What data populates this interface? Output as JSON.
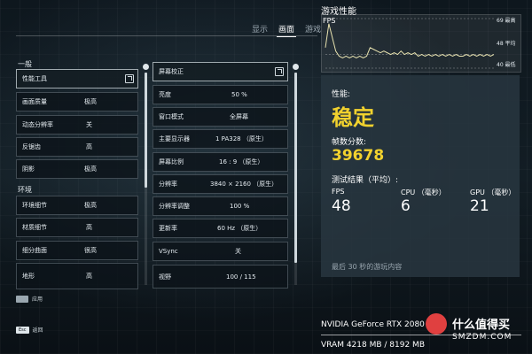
{
  "tabs": [
    "显示",
    "画面",
    "游戏"
  ],
  "active_tab": "画面",
  "sections": {
    "general": "一般",
    "environment": "环境"
  },
  "left_column": [
    {
      "label": "性能工具",
      "value": "",
      "icon": "external-icon"
    },
    {
      "label": "画面质量",
      "value": "极高"
    },
    {
      "label": "动态分辨率",
      "value": "关"
    },
    {
      "label": "反锯齿",
      "value": "高"
    },
    {
      "label": "阴影",
      "value": "极高"
    },
    {
      "label": "环境细节",
      "value": "极高"
    },
    {
      "label": "材质细节",
      "value": "高"
    },
    {
      "label": "细分曲面",
      "value": "很高"
    },
    {
      "label": "地形",
      "value": "高"
    }
  ],
  "right_column": [
    {
      "label": "屏幕校正",
      "value": "",
      "icon": "external-icon"
    },
    {
      "label": "亮度",
      "value": "50 %"
    },
    {
      "label": "窗口模式",
      "value": "全屏幕"
    },
    {
      "label": "主要显示器",
      "value": "1 PA328 （原生）"
    },
    {
      "label": "屏幕比例",
      "value": "16 : 9 （原生）"
    },
    {
      "label": "分辨率",
      "value": "3840 × 2160 （原生）"
    },
    {
      "label": "分辨率调整",
      "value": "100 %"
    },
    {
      "label": "更新率",
      "value": "60 Hz （原生）"
    },
    {
      "label": "VSync",
      "value": "关"
    },
    {
      "label": "视野",
      "value": "100 / 115"
    }
  ],
  "bottom": {
    "apply": "应用",
    "back_key": "Esc",
    "back": "返回"
  },
  "perf": {
    "title": "游戏性能",
    "graph_label": "FPS",
    "graph_max": "69 最高",
    "graph_avg": "48 平均",
    "graph_min": "40 最低",
    "graph_values": [
      52,
      66,
      58,
      50,
      47,
      46,
      47,
      46,
      47,
      46,
      47,
      46,
      47,
      52,
      51,
      50,
      49,
      50,
      49,
      48,
      49,
      48,
      50,
      48,
      49,
      48,
      49,
      47,
      48,
      47,
      48,
      47,
      48,
      47,
      48,
      47,
      48,
      47,
      48,
      47,
      47,
      48,
      47,
      48,
      47,
      48,
      47,
      48,
      47,
      48
    ],
    "perf_label": "性能:",
    "perf_value": "稳定",
    "score_label": "帧数分数:",
    "score_value": "39678",
    "results_label": "测试结果（平均）:",
    "fps_label": "FPS",
    "fps_value": "48",
    "cpu_label": "CPU （毫秒）",
    "cpu_value": "6",
    "gpu_label": "GPU （毫秒）",
    "gpu_value": "21",
    "footer": "最后 30 秒的游玩内容",
    "gpu_name": "NVIDIA GeForce RTX 2080",
    "vram": "VRAM 4218 MB / 8192 MB"
  },
  "watermark": {
    "text": "什么值得买",
    "sub": "SMZDM.COM"
  },
  "colors": {
    "accent_yellow": "#f2d22e",
    "graph_line": "#e8e3b0"
  }
}
